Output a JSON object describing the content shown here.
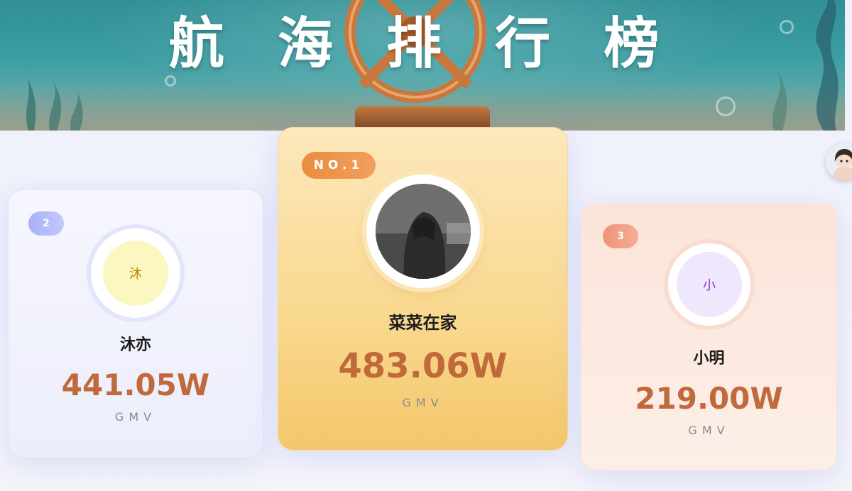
{
  "banner": {
    "title": "航 海 排 行 榜"
  },
  "leaderboard": [
    {
      "rank_label": "2",
      "avatar_char": "沐",
      "name": "沐亦",
      "value": "441.05W",
      "metric": "GMV"
    },
    {
      "rank_label": "NO.1",
      "name": "菜菜在家",
      "value": "483.06W",
      "metric": "GMV"
    },
    {
      "rank_label": "3",
      "avatar_char": "小",
      "name": "小明",
      "value": "219.00W",
      "metric": "GMV"
    }
  ],
  "colors": {
    "value_text": "#c06a3c",
    "rank1_pill": "#e98c3f",
    "rank2_pill": "#a9b1fa",
    "rank3_pill": "#ee9478"
  },
  "icons": {
    "banner_decoration": "trophy-ship-wheel-icon",
    "floating_user": "user-avatar-icon"
  }
}
